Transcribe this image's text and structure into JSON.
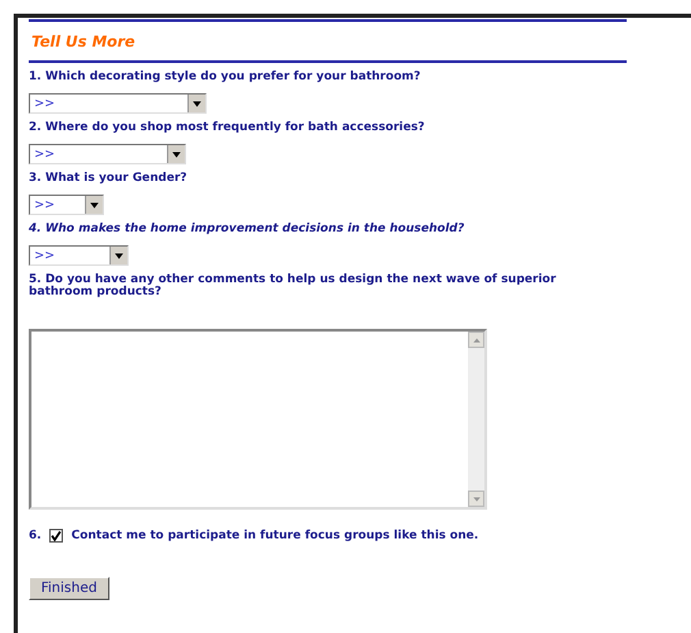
{
  "title": "Tell Us More",
  "questions": [
    {
      "kind": "select",
      "number": "1.",
      "text": "Which decorating style do you prefer for your bathroom?",
      "italic": false,
      "value": ">>"
    },
    {
      "kind": "select",
      "number": "2.",
      "text": "Where do you shop most frequently for bath accessories?",
      "italic": false,
      "value": ">>"
    },
    {
      "kind": "select",
      "number": "3.",
      "text": "What is your Gender?",
      "italic": false,
      "value": ">>"
    },
    {
      "kind": "select",
      "number": "4.",
      "text": "Who makes the home improvement decisions in the household?",
      "italic": true,
      "value": ">>"
    },
    {
      "kind": "textarea",
      "number": "5.",
      "text": "Do you have any other comments to help us design the next wave of superior bathroom products?",
      "italic": false
    },
    {
      "kind": "checkbox",
      "number": "6.",
      "text": "Contact me to participate in future focus groups like this one.",
      "italic": false,
      "checked": true
    }
  ],
  "button": "Finished"
}
